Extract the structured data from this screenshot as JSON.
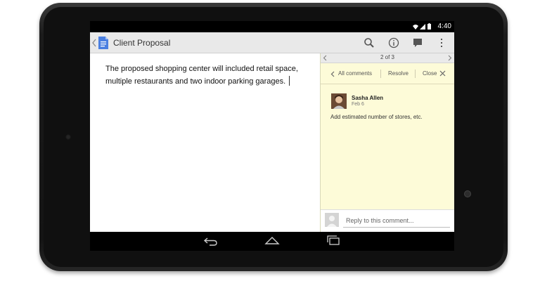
{
  "status_bar": {
    "time": "4:40",
    "icons": [
      "wifi-icon",
      "signal-icon",
      "battery-icon"
    ]
  },
  "action_bar": {
    "title": "Client Proposal",
    "buttons": [
      "search-icon",
      "info-icon",
      "comment-icon",
      "overflow-menu-icon"
    ]
  },
  "document": {
    "text": "The proposed shopping center will included retail space, multiple restaurants and two indoor parking garages."
  },
  "comments_panel": {
    "pager": "2 of 3",
    "all_comments": "All comments",
    "resolve": "Resolve",
    "close": "Close",
    "comment": {
      "author": "Sasha Allen",
      "date": "Feb 6",
      "body": "Add estimated number of stores, etc."
    },
    "reply_placeholder": "Reply to this comment..."
  },
  "nav_bar": {
    "buttons": [
      "back-icon",
      "home-icon",
      "recent-apps-icon"
    ]
  },
  "colors": {
    "action_bar": "#e9e9e9",
    "comment_panel": "#fdfbd8",
    "docs_blue": "#4a7fe0"
  }
}
